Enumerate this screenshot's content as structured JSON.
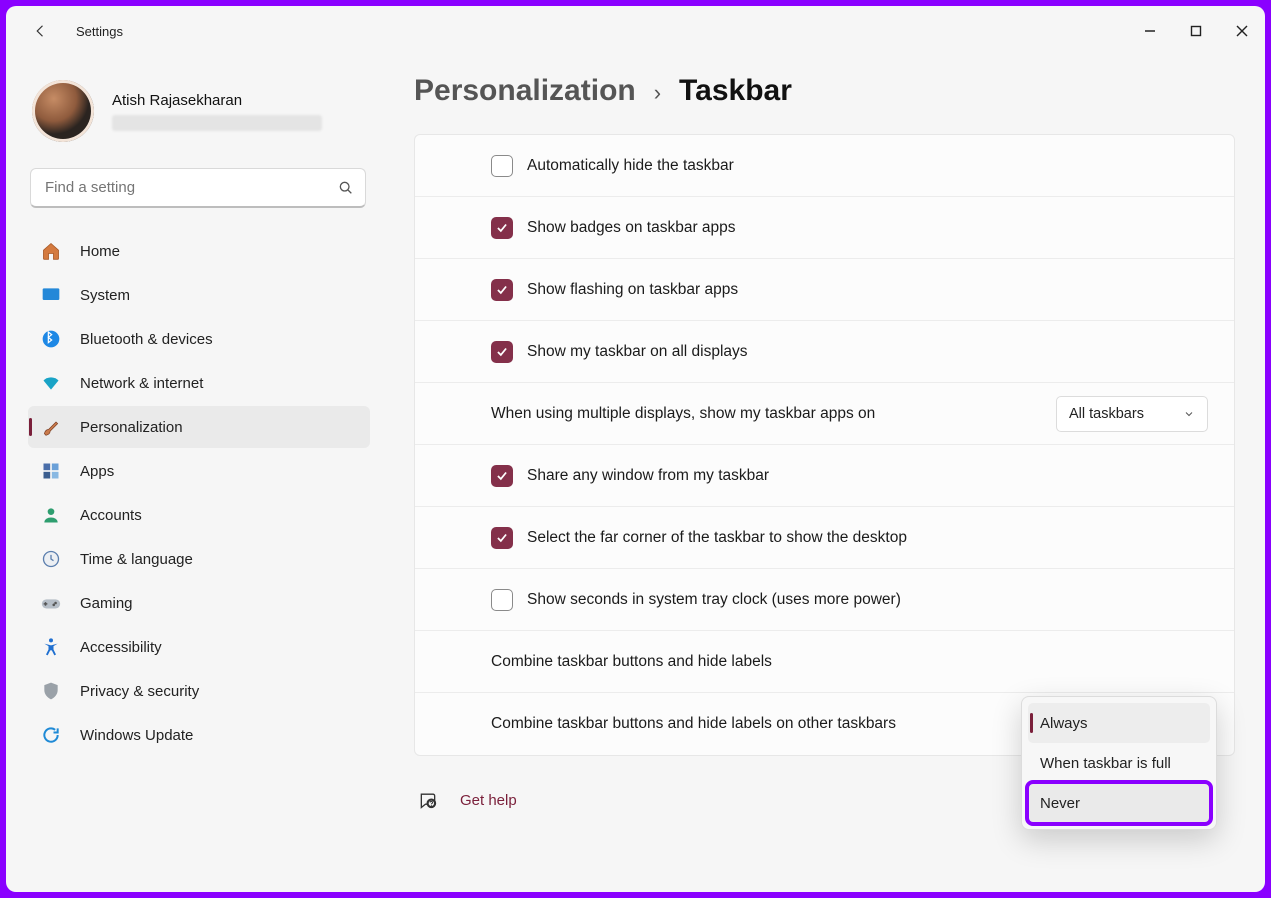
{
  "window": {
    "title": "Settings"
  },
  "user": {
    "name": "Atish Rajasekharan"
  },
  "search": {
    "placeholder": "Find a setting"
  },
  "nav": {
    "items": [
      {
        "label": "Home"
      },
      {
        "label": "System"
      },
      {
        "label": "Bluetooth & devices"
      },
      {
        "label": "Network & internet"
      },
      {
        "label": "Personalization"
      },
      {
        "label": "Apps"
      },
      {
        "label": "Accounts"
      },
      {
        "label": "Time & language"
      },
      {
        "label": "Gaming"
      },
      {
        "label": "Accessibility"
      },
      {
        "label": "Privacy & security"
      },
      {
        "label": "Windows Update"
      }
    ]
  },
  "breadcrumb": {
    "parent": "Personalization",
    "current": "Taskbar"
  },
  "settings": {
    "auto_hide": {
      "label": "Automatically hide the taskbar",
      "checked": false
    },
    "show_badges": {
      "label": "Show badges on taskbar apps",
      "checked": true
    },
    "show_flashing": {
      "label": "Show flashing on taskbar apps",
      "checked": true
    },
    "all_displays": {
      "label": "Show my taskbar on all displays",
      "checked": true
    },
    "multi_display": {
      "label": "When using multiple displays, show my taskbar apps on",
      "value": "All taskbars"
    },
    "share_window": {
      "label": "Share any window from my taskbar",
      "checked": true
    },
    "far_corner": {
      "label": "Select the far corner of the taskbar to show the desktop",
      "checked": true
    },
    "show_seconds": {
      "label": "Show seconds in system tray clock (uses more power)",
      "checked": false
    },
    "combine_primary": {
      "label": "Combine taskbar buttons and hide labels"
    },
    "combine_other": {
      "label": "Combine taskbar buttons and hide labels on other taskbars"
    }
  },
  "combine_dropdown": {
    "options": [
      {
        "label": "Always",
        "selected": true
      },
      {
        "label": "When taskbar is full"
      },
      {
        "label": "Never",
        "highlighted": true
      }
    ]
  },
  "help": {
    "label": "Get help"
  }
}
